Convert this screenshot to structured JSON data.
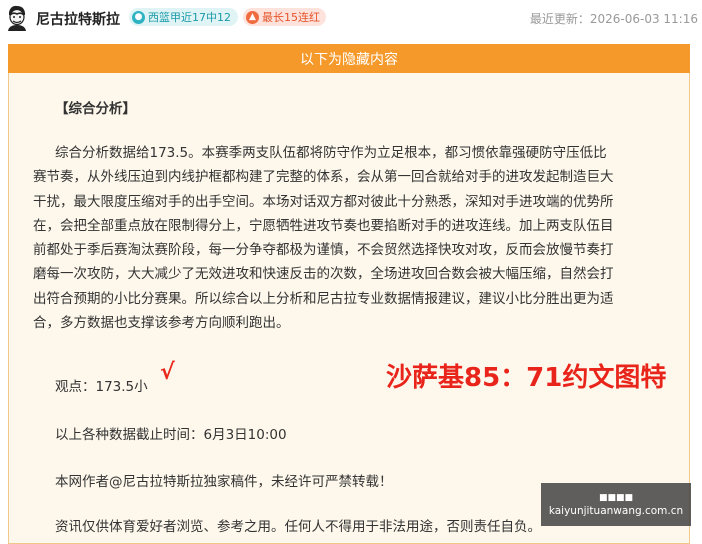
{
  "header": {
    "author_name": "尼古拉特斯拉",
    "record_badge": "西篮甲近17中12",
    "streak_badge": "最长15连红",
    "last_updated": "最近更新：2026-06-03 11:16"
  },
  "content": {
    "hidden_banner": "以下为隐藏内容",
    "section_title": "【综合分析】",
    "paragraph_lines": [
      "综合分析数据给173.5。本赛季两支队伍都将防守作为立足根本，都习惯依靠强硬防守压低比",
      "赛节奏，从外线压迫到内线护框都构建了完整的体系，会从第一回合就给对手的进攻发起制造巨大",
      "干扰，最大限度压缩对手的出手空间。本场对话双方都对彼此十分熟悉，深知对手进攻端的优势所",
      "在，会把全部重点放在限制得分上，宁愿牺牲进攻节奏也要掐断对手的进攻连线。加上两支队伍目",
      "前都处于季后赛淘汰赛阶段，每一分争夺都极为谨慎，不会贸然选择快攻对攻，反而会放慢节奏打",
      "磨每一次攻防，大大减少了无效进攻和快速反击的次数，全场进攻回合数会被大幅压缩，自然会打",
      "出符合预期的小比分赛果。所以综合以上分析和尼古拉专业数据情报建议，建议小比分胜出更为适",
      "合，多方数据也支撑该参考方向顺利跑出。"
    ],
    "opinion": "观点：173.5小",
    "check_mark": "√",
    "score_overlay": "沙萨基85：71约文图特",
    "deadline": "以上各种数据截止时间：6月3日10:00",
    "copyright": "本网作者@尼古拉特斯拉独家稿件，未经许可严禁转载！",
    "disclaimer": "资讯仅供体育爱好者浏览、参考之用。任何人不得用于非法用途，否则责任自负。"
  },
  "watermark": {
    "logo_text": "■■■■",
    "domain": "kaiyunjituanwang.com.cn"
  },
  "colors": {
    "accent_orange": "#f59a2a",
    "record_teal": "#2fb3c2",
    "streak_red": "#f06b40",
    "highlight_red": "#e8241b"
  },
  "icons": {
    "record_badge_icon": "basketball-icon",
    "streak_badge_icon": "flame-icon"
  }
}
